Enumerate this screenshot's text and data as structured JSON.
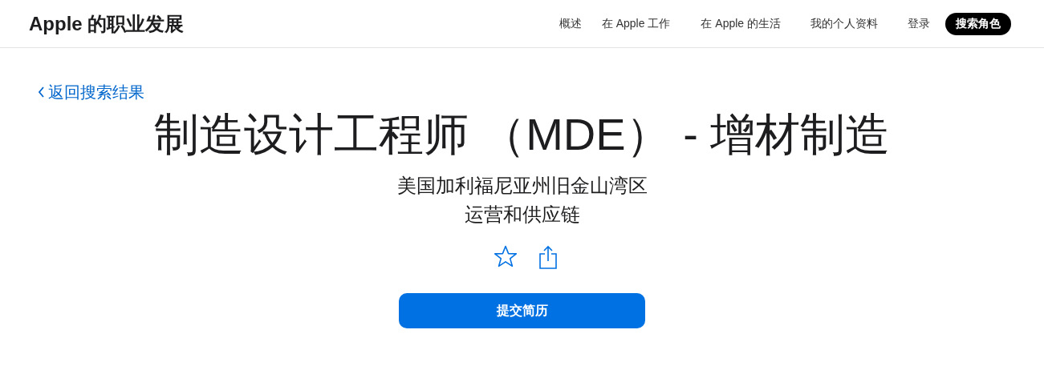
{
  "header": {
    "logo": "Apple 的职业发展",
    "nav": [
      "概述",
      "在 Apple 工作",
      "在 Apple 的生活",
      "我的个人资料",
      "登录"
    ],
    "search_button": "搜索角色"
  },
  "back_link": "返回搜索结果",
  "job": {
    "title": "制造设计工程师 （MDE） - 增材制造",
    "location": "美国加利福尼亚州旧金山湾区",
    "team": "运营和供应链"
  },
  "apply_button": "提交简历"
}
